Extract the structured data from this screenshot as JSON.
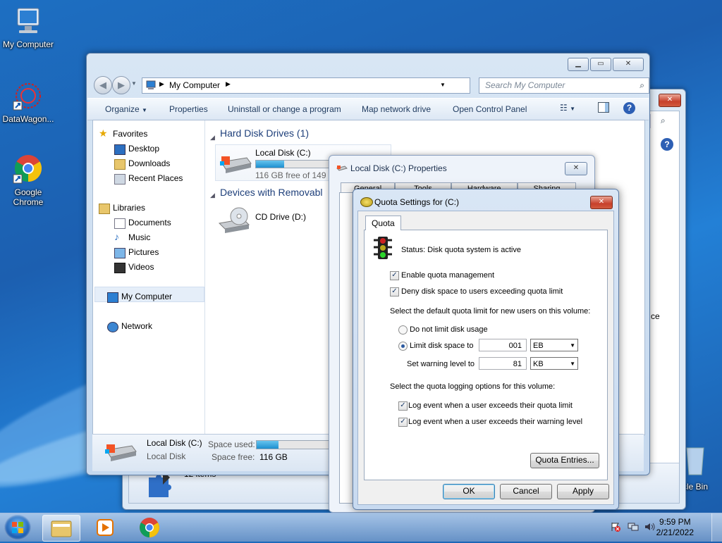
{
  "desktop": {
    "icons": [
      {
        "label": "My Computer"
      },
      {
        "label": "DataWagon..."
      },
      {
        "label": "Google Chrome"
      },
      {
        "label": "cle Bin"
      }
    ]
  },
  "back_window": {
    "status_items": "12 items",
    "partial_text": "ce"
  },
  "explorer": {
    "address": "My Computer",
    "search_placeholder": "Search My Computer",
    "commands": [
      "Organize",
      "Properties",
      "Uninstall or change a program",
      "Map network drive",
      "Open Control Panel"
    ],
    "nav": {
      "favorites": "Favorites",
      "desktop": "Desktop",
      "downloads": "Downloads",
      "recent": "Recent Places",
      "libraries": "Libraries",
      "documents": "Documents",
      "music": "Music",
      "pictures": "Pictures",
      "videos": "Videos",
      "computer": "My Computer",
      "network": "Network"
    },
    "groups": {
      "hdd": "Hard Disk Drives (1)",
      "removable": "Devices with Removabl"
    },
    "drives": {
      "c_name": "Local Disk (C:)",
      "c_free": "116 GB free of 149 G",
      "c_used_fraction": 0.22,
      "d_name": "CD Drive (D:)"
    },
    "details": {
      "name": "Local Disk (C:)",
      "type": "Local Disk",
      "space_used_label": "Space used:",
      "space_free_label": "Space free:",
      "space_free": "116 GB"
    }
  },
  "properties": {
    "title": "Local Disk (C:) Properties",
    "tabs": [
      "General",
      "Tools",
      "Hardware",
      "Sharing"
    ]
  },
  "quota": {
    "title": "Quota Settings for  (C:)",
    "tab": "Quota",
    "status": "Status:  Disk quota system is active",
    "enable": "Enable quota management",
    "deny": "Deny disk space to users exceeding quota limit",
    "default_heading": "Select the default quota limit for new users on this volume:",
    "no_limit": "Do not limit disk usage",
    "limit": "Limit disk space to",
    "limit_value": "001",
    "limit_unit": "EB",
    "warning": "Set warning level to",
    "warning_value": "81",
    "warning_unit": "KB",
    "logging_heading": "Select the quota logging options for this volume:",
    "log_limit": "Log event when a user exceeds their quota limit",
    "log_warning": "Log event when a user exceeds their warning level",
    "entries_button": "Quota Entries...",
    "ok": "OK",
    "cancel": "Cancel",
    "apply": "Apply"
  },
  "taskbar": {
    "time": "9:59 PM",
    "date": "2/21/2022"
  }
}
